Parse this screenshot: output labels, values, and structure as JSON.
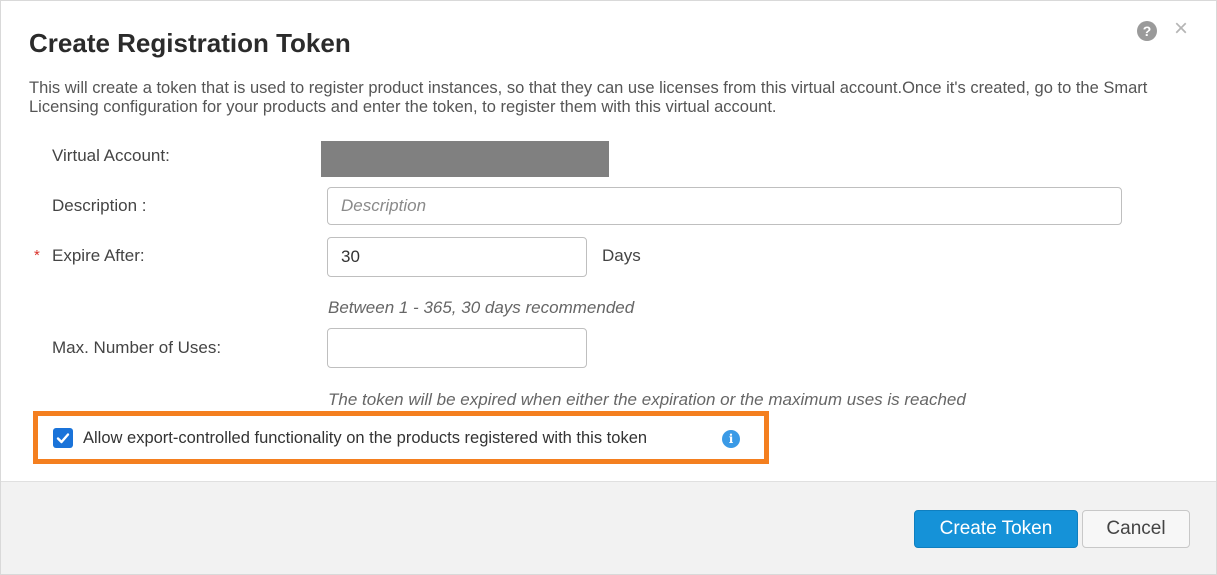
{
  "dialog": {
    "title": "Create Registration Token",
    "help_icon": "?",
    "close_icon": "×",
    "intro": "This will create a token that is used to register product instances, so that they can use licenses from this virtual account.Once it's created, go to the Smart Licensing configuration for your products and enter the token, to register them with this virtual account."
  },
  "form": {
    "virtual_account": {
      "label": "Virtual Account:",
      "value": ""
    },
    "description": {
      "label": "Description :",
      "placeholder": "Description",
      "value": ""
    },
    "expire_after": {
      "label": "Expire After:",
      "required_marker": "*",
      "value": "30",
      "unit": "Days",
      "hint": "Between 1 - 365, 30 days recommended"
    },
    "max_uses": {
      "label": "Max. Number of Uses:",
      "value": "",
      "hint": "The token will be expired when either the expiration or the maximum uses is reached"
    },
    "export_control": {
      "label": "Allow export-controlled functionality on the products registered with this token",
      "checked": true,
      "info_icon": "i"
    }
  },
  "footer": {
    "create_label": "Create Token",
    "cancel_label": "Cancel"
  },
  "colors": {
    "primary": "#1592d8",
    "highlight": "#f47f1f",
    "checkbox": "#1a73d9",
    "required": "#d9322b"
  }
}
